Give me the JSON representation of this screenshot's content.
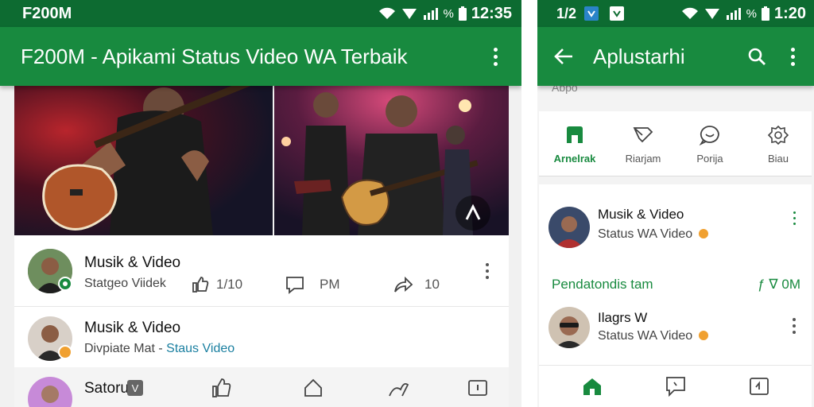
{
  "left": {
    "status": {
      "app_label": "F200M",
      "time": "12:35"
    },
    "toolbar": {
      "title": "F200M - Apikami Status Video WA Terbaik"
    },
    "items": [
      {
        "title": "Musik & Video",
        "subtitle": "Statgeo Viidek",
        "likes": "1/10",
        "comments": "PM",
        "shares": "10"
      },
      {
        "title": "Musik & Video",
        "subtitle_prefix": "Divpiate Mat - ",
        "subtitle_link": "Staus Video"
      },
      {
        "title": "Satoru"
      }
    ]
  },
  "right": {
    "status": {
      "left_text": "1/2",
      "time": "1:20"
    },
    "toolbar": {
      "title": "Aplustarhi"
    },
    "section_label": "Abpo",
    "tabs": [
      {
        "label": "Arnelrak",
        "icon": "app-icon",
        "active": true
      },
      {
        "label": "Riarjam",
        "icon": "share-icon",
        "active": false
      },
      {
        "label": "Porija",
        "icon": "chat-icon",
        "active": false
      },
      {
        "label": "Biau",
        "icon": "settings-icon",
        "active": false
      }
    ],
    "items": [
      {
        "title": "Musik & Video",
        "subtitle": "Status WA Video"
      },
      {
        "title": "Ilagrs W",
        "subtitle": "Status WA Video"
      }
    ],
    "promo": {
      "label": "Pendatondis tam",
      "value": "ƒ ∇ 0M"
    }
  },
  "colors": {
    "primary": "#188a3f",
    "status_bar": "#0d6b31",
    "accent_orange": "#f0a030"
  }
}
